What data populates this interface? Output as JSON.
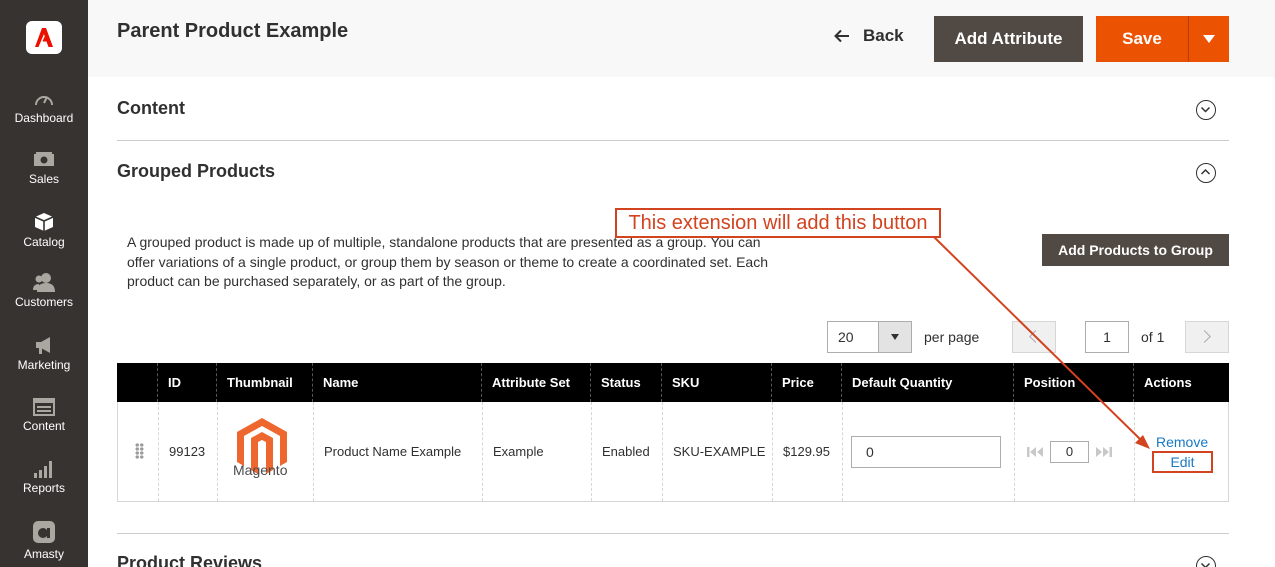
{
  "sidebar": {
    "items": [
      {
        "label": "Dashboard",
        "icon": "dashboard-icon"
      },
      {
        "label": "Sales",
        "icon": "sales-icon"
      },
      {
        "label": "Catalog",
        "icon": "catalog-icon"
      },
      {
        "label": "Customers",
        "icon": "customers-icon"
      },
      {
        "label": "Marketing",
        "icon": "marketing-icon"
      },
      {
        "label": "Content",
        "icon": "content-icon"
      },
      {
        "label": "Reports",
        "icon": "reports-icon"
      },
      {
        "label": "Amasty",
        "icon": "amasty-icon"
      }
    ]
  },
  "header": {
    "title": "Parent Product Example",
    "back_label": "Back",
    "add_attribute_label": "Add Attribute",
    "save_label": "Save"
  },
  "sections": {
    "content_title": "Content",
    "grouped_title": "Grouped Products",
    "reviews_title": "Product Reviews"
  },
  "grouped": {
    "description": "A grouped product is made up of multiple, standalone products that are presented as a group. You can offer variations of a single product, or group them by season or theme to create a coordinated set. Each product can be purchased separately, or as part of the group.",
    "add_products_label": "Add Products to Group",
    "pager": {
      "per_page_value": "20",
      "per_page_label": "per page",
      "current_page": "1",
      "of_label": "of 1"
    },
    "columns": [
      "ID",
      "Thumbnail",
      "Name",
      "Attribute Set",
      "Status",
      "SKU",
      "Price",
      "Default Quantity",
      "Position",
      "Actions"
    ],
    "row": {
      "id": "99123",
      "thumbnail_text": "Magento",
      "name": "Product Name Example",
      "attribute_set": "Example",
      "status": "Enabled",
      "sku": "SKU-EXAMPLE",
      "price": "$129.95",
      "default_quantity": "0",
      "position": "0",
      "remove_label": "Remove",
      "edit_label": "Edit"
    }
  },
  "annotation": {
    "text": "This extension will add this button",
    "color": "#d2431f"
  },
  "colors": {
    "accent": "#eb5202",
    "dark_button": "#514943",
    "sidebar": "#373330",
    "link": "#1979c3"
  }
}
